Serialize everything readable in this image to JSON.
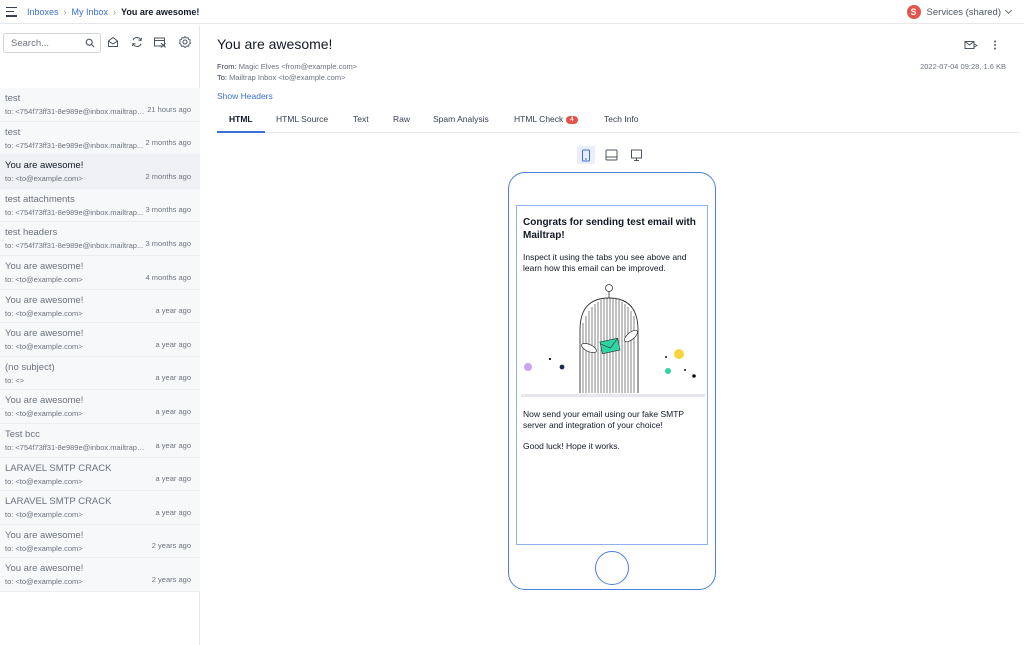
{
  "breadcrumb": {
    "inboxes": "Inboxes",
    "my_inbox": "My Inbox",
    "current": "You are awesome!"
  },
  "account": {
    "initial": "S",
    "name": "Services (shared)",
    "avatar_color": "#e5534b"
  },
  "search": {
    "placeholder": "Search..."
  },
  "sidebar_icons": [
    "search-icon",
    "mark-read-icon",
    "refresh-icon",
    "clear-inbox-icon",
    "settings-icon"
  ],
  "messages": [
    {
      "subject": "test",
      "to": "to: <754f73ff31-8e989e@inbox.mailtrap.i...",
      "time": "21 hours ago"
    },
    {
      "subject": "test",
      "to": "to: <754f73ff31-8e989e@inbox.mailtrap...",
      "time": "2 months ago"
    },
    {
      "subject": "You are awesome!",
      "to": "to: <to@example.com>",
      "time": "2 months ago",
      "active": true
    },
    {
      "subject": "test attachments",
      "to": "to: <754f73ff31-8e989e@inbox.mailtrap...",
      "time": "3 months ago"
    },
    {
      "subject": "test headers",
      "to": "to: <754f73ff31-8e989e@inbox.mailtrap...",
      "time": "3 months ago"
    },
    {
      "subject": "You are awesome!",
      "to": "to: <to@example.com>",
      "time": "4 months ago"
    },
    {
      "subject": "You are awesome!",
      "to": "to: <to@example.com>",
      "time": "a year ago"
    },
    {
      "subject": "You are awesome!",
      "to": "to: <to@example.com>",
      "time": "a year ago"
    },
    {
      "subject": "(no subject)",
      "to": "to: <>",
      "time": "a year ago"
    },
    {
      "subject": "You are awesome!",
      "to": "to: <to@example.com>",
      "time": "a year ago"
    },
    {
      "subject": "Test bcc",
      "to": "to: <754f73ff31-8e989e@inbox.mailtrap.io>",
      "time": "a year ago"
    },
    {
      "subject": "LARAVEL SMTP CRACK",
      "to": "to: <to@example.com>",
      "time": "a year ago"
    },
    {
      "subject": "LARAVEL SMTP CRACK",
      "to": "to: <to@example.com>",
      "time": "a year ago"
    },
    {
      "subject": "You are awesome!",
      "to": "to: <to@example.com>",
      "time": "2 years ago"
    },
    {
      "subject": "You are awesome!",
      "to": "to: <to@example.com>",
      "time": "2 years ago"
    }
  ],
  "email": {
    "title": "You are awesome!",
    "from_label": "From:",
    "from_value": "Magic Elves <from@example.com>",
    "to_label": "To:",
    "to_value": "Mailtrap Inbox <to@example.com>",
    "meta": "2022-07-04 09:28, 1.6 KB",
    "show_headers": "Show Headers"
  },
  "tabs": [
    {
      "label": "HTML",
      "active": true
    },
    {
      "label": "HTML Source"
    },
    {
      "label": "Text"
    },
    {
      "label": "Raw"
    },
    {
      "label": "Spam Analysis"
    },
    {
      "label": "HTML Check",
      "badge": "4"
    },
    {
      "label": "Tech Info"
    }
  ],
  "device_modes": [
    "mobile-device-icon",
    "tablet-device-icon",
    "desktop-device-icon"
  ],
  "preview": {
    "heading": "Congrats for sending test email with Mailtrap!",
    "intro": "Inspect it using the tabs you see above and learn how this email can be improved.",
    "body": "Now send your email using our fake SMTP server and integration of your choice!",
    "signoff": "Good luck! Hope it works."
  },
  "colors": {
    "accent": "#3b6fd6",
    "badge": "#e5534b",
    "phone_border": "#4a7fe0",
    "illustration_green": "#2fd4a3",
    "illustration_yellow": "#f7d63c",
    "illustration_purple": "#c9a4f0"
  }
}
